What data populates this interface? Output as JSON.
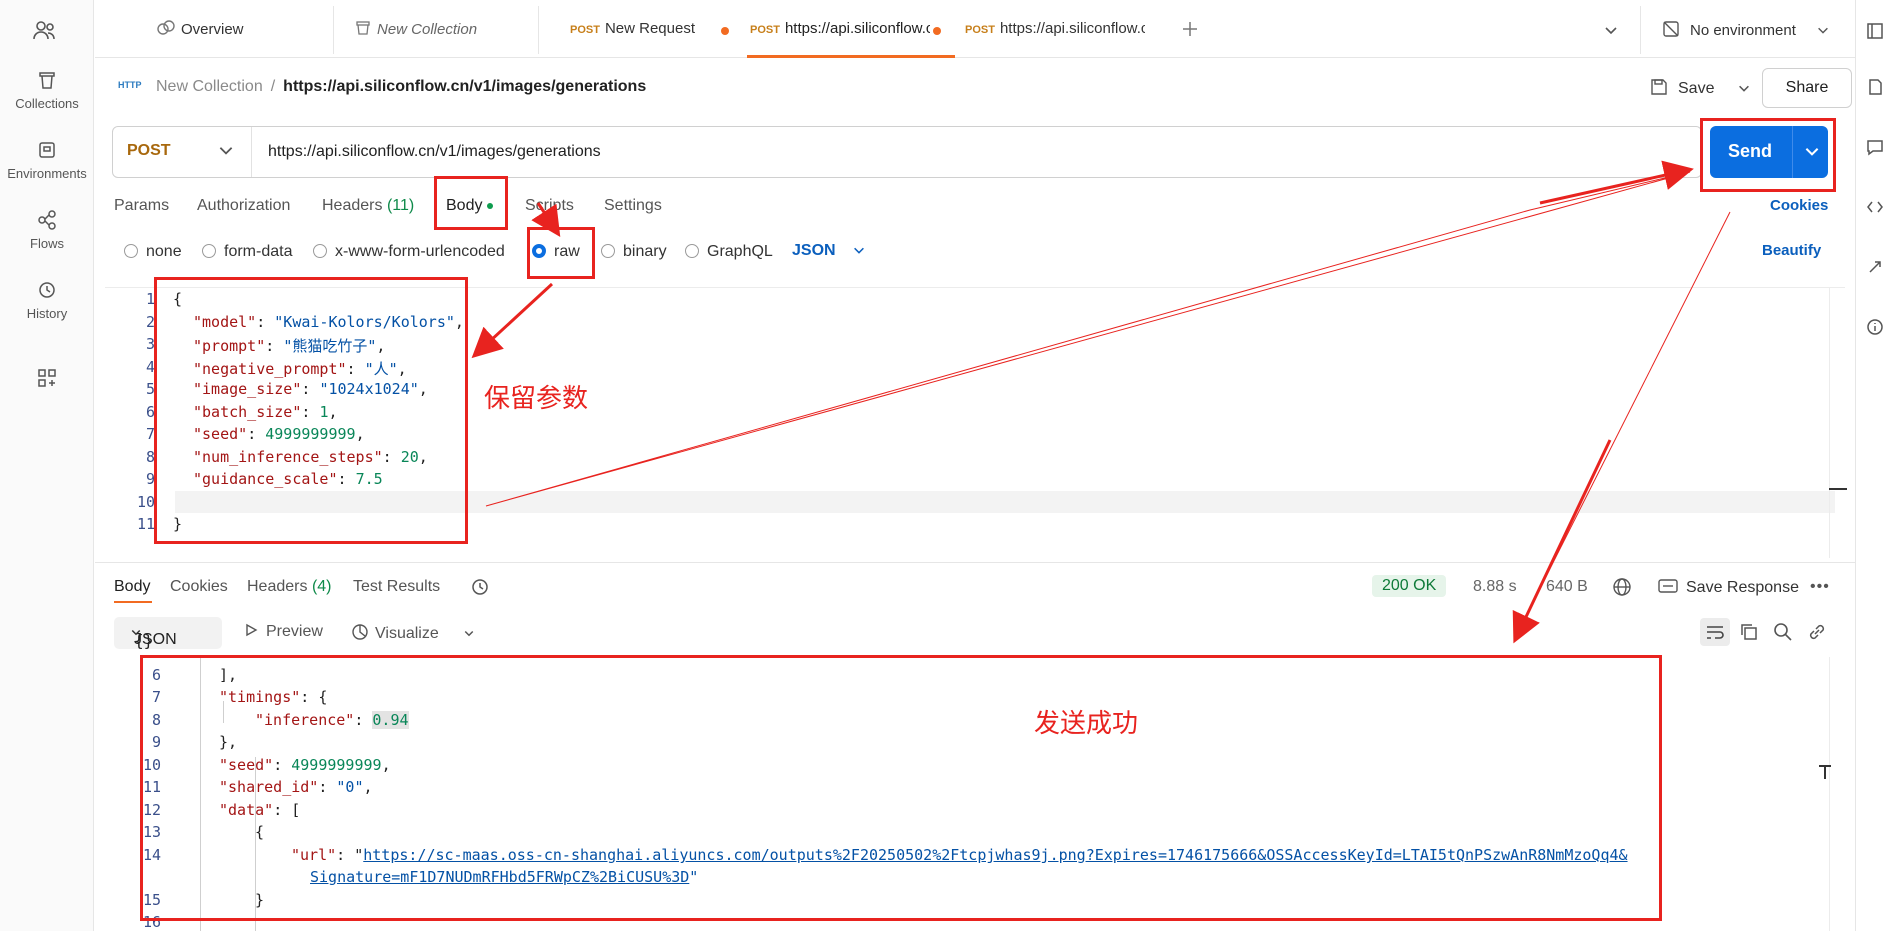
{
  "rail": {
    "items": [
      {
        "label": "Collections",
        "icon": "trash-can-icon"
      },
      {
        "label": "Environments",
        "icon": "environment-icon"
      },
      {
        "label": "Flows",
        "icon": "flows-icon"
      },
      {
        "label": "History",
        "icon": "history-icon"
      }
    ]
  },
  "tabs": {
    "overview": "Overview",
    "new_collection": "New Collection",
    "tab1_method": "POST",
    "tab1_label": "New Request",
    "tab2_method": "POST",
    "tab2_label": "https://api.siliconflow.c",
    "tab3_method": "POST",
    "tab3_label": "https://api.siliconflow.c",
    "environment": "No environment"
  },
  "breadcrumb": {
    "badge": "HTTP",
    "collection": "New Collection",
    "separator": "/",
    "request": "https://api.siliconflow.cn/v1/images/generations"
  },
  "actions": {
    "save": "Save",
    "share": "Share",
    "send": "Send"
  },
  "request": {
    "method": "POST",
    "url": "https://api.siliconflow.cn/v1/images/generations",
    "tabs": {
      "params": "Params",
      "authorization": "Authorization",
      "headers": "Headers",
      "headers_count": "(11)",
      "body": "Body",
      "scripts": "Scripts",
      "settings": "Settings"
    },
    "cookies": "Cookies",
    "body_types": {
      "none": "none",
      "form_data": "form-data",
      "urlencoded": "x-www-form-urlencoded",
      "raw": "raw",
      "binary": "binary",
      "graphql": "GraphQL"
    },
    "selected_body_type": "raw",
    "format": "JSON",
    "beautify": "Beautify",
    "lines": [
      "1",
      "2",
      "3",
      "4",
      "5",
      "6",
      "7",
      "8",
      "9",
      "10",
      "11"
    ],
    "body": {
      "open": "{",
      "close": "}",
      "k_model": "\"model\"",
      "v_model": "\"Kwai-Kolors/Kolors\"",
      "k_prompt": "\"prompt\"",
      "v_prompt": "\"熊猫吃竹子\"",
      "k_negative": "\"negative_prompt\"",
      "v_negative": "\"人\"",
      "k_size": "\"image_size\"",
      "v_size": "\"1024x1024\"",
      "k_batch": "\"batch_size\"",
      "v_batch": "1",
      "k_seed": "\"seed\"",
      "v_seed": "4999999999",
      "k_steps": "\"num_inference_steps\"",
      "v_steps": "20",
      "k_scale": "\"guidance_scale\"",
      "v_scale": "7.5"
    }
  },
  "response": {
    "tabs": {
      "body": "Body",
      "cookies": "Cookies",
      "headers": "Headers",
      "headers_count": "(4)",
      "test_results": "Test Results"
    },
    "status": "200 OK",
    "time": "8.88 s",
    "size": "640 B",
    "save_response": "Save Response",
    "format": "JSON",
    "preview": "Preview",
    "visualize": "Visualize",
    "lines": [
      "6",
      "7",
      "8",
      "9",
      "10",
      "11",
      "12",
      "13",
      "14",
      "15",
      "16"
    ],
    "body": {
      "l6": "],",
      "k_timings": "\"timings\"",
      "k_inference": "\"inference\"",
      "v_inference": "0.94",
      "l9": "},",
      "k_seed": "\"seed\"",
      "v_seed": "4999999999",
      "k_shared": "\"shared_id\"",
      "v_shared": "\"0\"",
      "k_data": "\"data\"",
      "open_obj": "{",
      "k_url": "\"url\"",
      "url_part1": "https://sc-maas.oss-cn-shanghai.aliyuncs.com/outputs%2F20250502%2Ftcpjwhas9j.png?Expires=1746175666&OSSAccessKeyId=LTAI5tQnPSzwAnR8NmMzoQq4&",
      "url_part2": "Signature=mF1D7NUDmRFHbd5FRWpCZ%2BiCUSU%3D",
      "close_obj": "}"
    }
  },
  "annotations": {
    "keep_params": "保留参数",
    "send_success": "发送成功",
    "color": "#e8231f"
  },
  "colors": {
    "accent": "#f26b21",
    "send": "#0b6ee0",
    "link": "#0b5fbd"
  }
}
